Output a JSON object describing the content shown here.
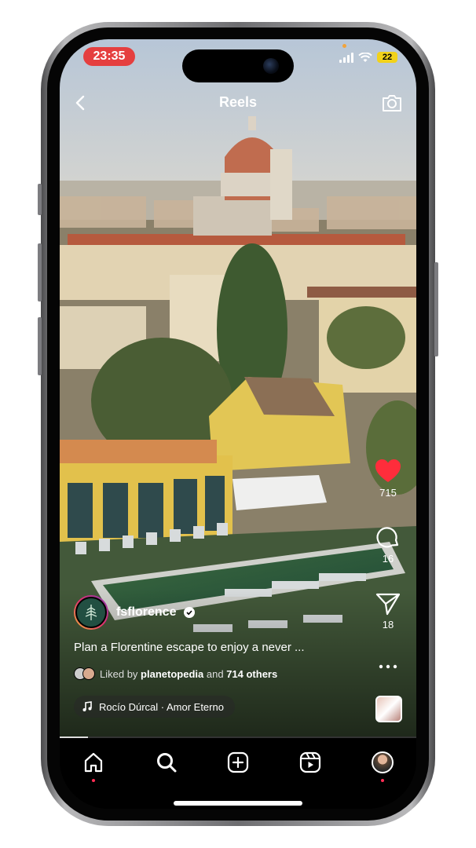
{
  "status_bar": {
    "time": "23:35",
    "battery": "22"
  },
  "header": {
    "title": "Reels"
  },
  "actions": {
    "likes": "715",
    "comments": "16",
    "shares": "18"
  },
  "post": {
    "username": "fsflorence",
    "caption": "Plan a Florentine escape to enjoy a never ...",
    "liked_prefix": "Liked by",
    "liked_user": "planetopedia",
    "liked_and": "and",
    "liked_others": "714 others",
    "audio": "Rocío Dúrcal · Amor Eterno"
  },
  "playback_progress": 0.08,
  "icons": [
    "back-icon",
    "camera-icon",
    "heart-icon",
    "comment-icon",
    "send-icon",
    "more-icon",
    "music-note-icon",
    "home-icon",
    "search-icon",
    "create-icon",
    "reels-icon",
    "profile-avatar"
  ],
  "colors": {
    "like": "#ff2d3b",
    "recording_pill": "#e53f3f",
    "notification_dot": "#ff2d55"
  }
}
